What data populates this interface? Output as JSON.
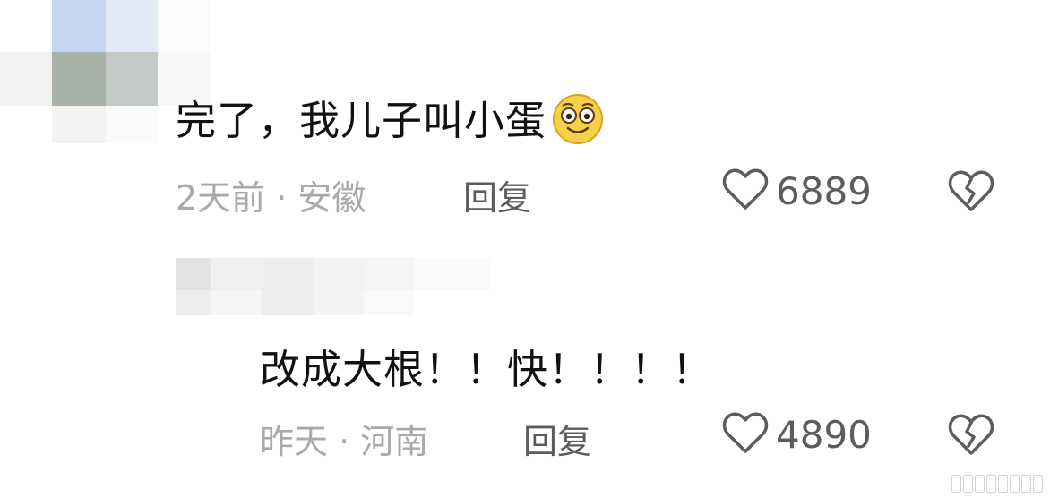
{
  "comments": [
    {
      "text": "完了，我儿子叫小蛋",
      "emoji": "smiley-emoji",
      "meta": "2天前 · 安徽",
      "reply_label": "回复",
      "like_count": "6889"
    },
    {
      "text": "改成大根！！快！！！！",
      "meta": "昨天 · 河南",
      "reply_label": "回复",
      "like_count": "4890"
    }
  ],
  "icons": {
    "like": "heart-outline-icon",
    "dislike": "broken-heart-icon"
  },
  "colors": {
    "text_primary": "#111111",
    "text_meta": "#a9a9a9",
    "text_action": "#5c5c5c",
    "emoji_fill": "#f7d04a"
  }
}
